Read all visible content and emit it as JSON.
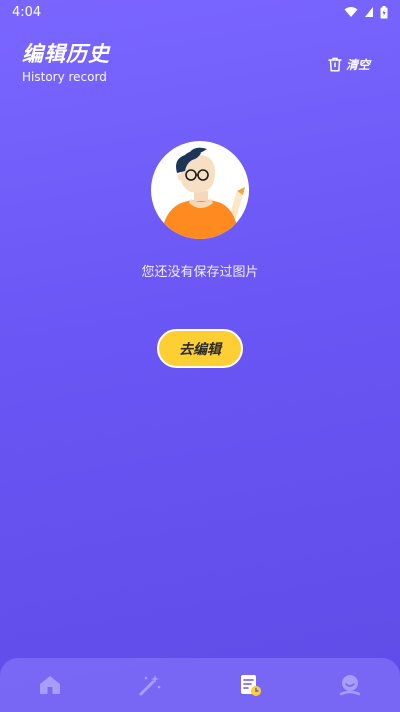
{
  "status_bar": {
    "time": "4:04",
    "icons": [
      "wifi-icon",
      "signal-icon",
      "battery-icon"
    ]
  },
  "header": {
    "title": "编辑历史",
    "subtitle": "History record",
    "clear_label": "清空",
    "clear_icon": "trash-icon"
  },
  "empty_state": {
    "illustration": "cartoon-person-avatar",
    "message": "您还没有保存过图片",
    "button_label": "去编辑"
  },
  "bottom_nav": {
    "items": [
      {
        "icon": "home-icon",
        "active": false
      },
      {
        "icon": "magic-wand-icon",
        "active": false
      },
      {
        "icon": "history-doc-icon",
        "active": true
      },
      {
        "icon": "profile-icon",
        "active": false
      }
    ]
  },
  "colors": {
    "background": "#6a56f4",
    "button": "#fdcf32",
    "nav_inactive": "#a89cff",
    "nav_active": "#ffffff"
  }
}
